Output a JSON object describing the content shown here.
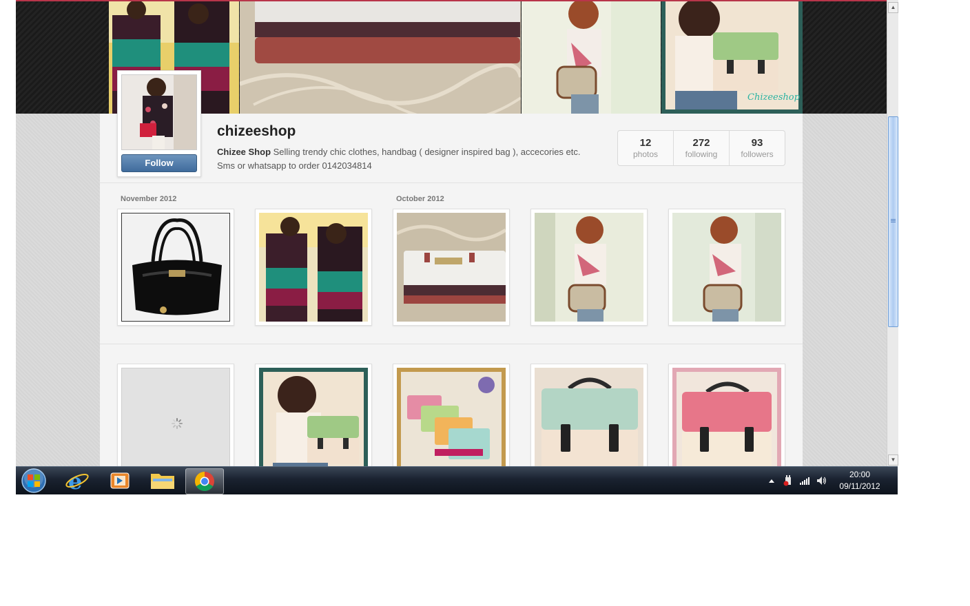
{
  "profile": {
    "username": "chizeeshop",
    "display_name": "Chizee Shop",
    "bio": "Selling trendy chic clothes, handbag ( designer inspired bag ), accecories etc. Sms or whatsapp to order 0142034814",
    "follow_label": "Follow"
  },
  "stats": [
    {
      "value": "12",
      "label": "photos"
    },
    {
      "value": "272",
      "label": "following"
    },
    {
      "value": "93",
      "label": "followers"
    }
  ],
  "sections": {
    "november": "November 2012",
    "october": "October 2012"
  },
  "photos": {
    "row1": [
      "black patent handbag",
      "striped top outfit",
      "clutch wallet",
      "girl with satchel",
      "girl with satchel 2"
    ],
    "row2": [
      "loading placeholder",
      "girl with green satchel",
      "pastel satchels",
      "mint satchel",
      "pink satchel"
    ]
  },
  "cover_watermark": "Chizeeshop",
  "taskbar": {
    "items": [
      "windows-start",
      "internet-explorer",
      "media-player",
      "file-explorer",
      "chrome"
    ],
    "active_item": "chrome",
    "clock_time": "20:00",
    "clock_date": "09/11/2012"
  },
  "colors": {
    "follow_button": "#4a76a8",
    "accent_bar": "#b8354a",
    "scroll_thumb": "#aecbf1"
  }
}
